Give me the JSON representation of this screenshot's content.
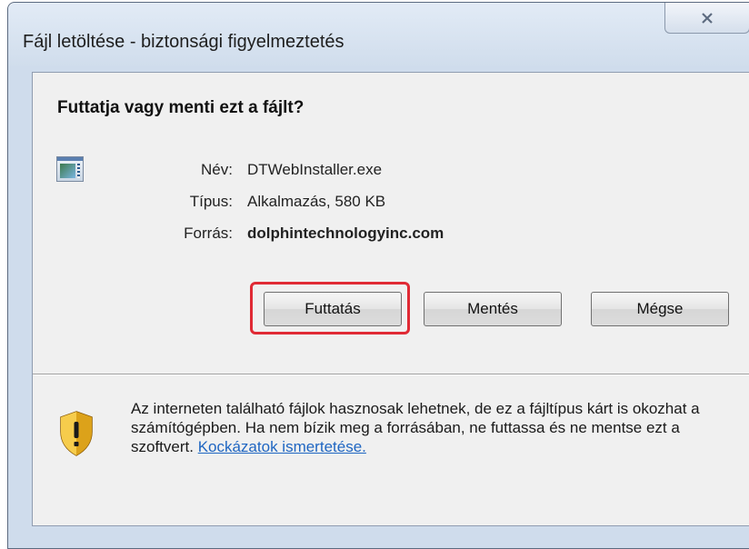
{
  "dialog": {
    "title": "Fájl letöltése - biztonsági figyelmeztetés",
    "question": "Futtatja vagy menti ezt a fájlt?"
  },
  "file": {
    "icon": "application-window-icon",
    "name_label": "Név:",
    "name_value": "DTWebInstaller.exe",
    "type_label": "Típus:",
    "type_value": "Alkalmazás, 580 KB",
    "source_label": "Forrás:",
    "source_value": "dolphintechnologyinc.com"
  },
  "buttons": {
    "run": "Futtatás",
    "save": "Mentés",
    "cancel": "Mégse"
  },
  "warning": {
    "icon": "shield-warning-icon",
    "text": "Az interneten található fájlok hasznosak lehetnek, de ez a fájltípus kárt is okozhat a számítógépben. Ha nem bízik meg a forrásában, ne futtassa és ne mentse ezt a szoftvert. ",
    "link": "Kockázatok ismertetése."
  },
  "colors": {
    "highlight": "#e02a35",
    "link": "#1f66c2",
    "frame": "#cfdcec"
  }
}
